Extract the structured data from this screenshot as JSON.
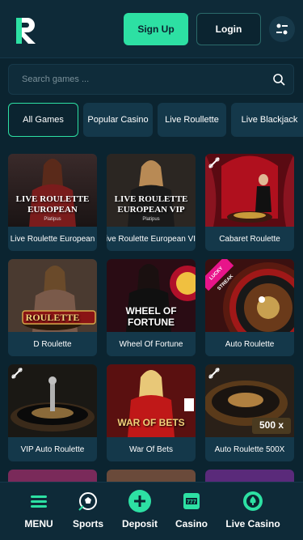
{
  "header": {
    "signup_label": "Sign Up",
    "login_label": "Login"
  },
  "search": {
    "placeholder": "Search games ..."
  },
  "tabs": [
    {
      "label": "All Games",
      "active": true
    },
    {
      "label": "Popular Casino",
      "active": false
    },
    {
      "label": "Live Roullette",
      "active": false
    },
    {
      "label": "Live Blackjack",
      "active": false
    }
  ],
  "games": [
    {
      "name": "Live Roulette European",
      "art_line1": "LIVE ROULETTE",
      "art_line2": "EUROPEAN",
      "art_sub": "Platipus"
    },
    {
      "name": "Live Roulette European VIP",
      "art_line1": "LIVE ROULETTE",
      "art_line2": "EUROPEAN VIP",
      "art_sub": "Platipus"
    },
    {
      "name": "Cabaret Roulette"
    },
    {
      "name": "D Roulette",
      "art_line1": "ROULETTE"
    },
    {
      "name": "Wheel Of Fortune",
      "art_line1": "WHEEL OF",
      "art_line2": "FORTUNE"
    },
    {
      "name": "Auto Roulette",
      "badge": "LUCKY STREAK"
    },
    {
      "name": "VIP Auto Roulette"
    },
    {
      "name": "War Of Bets",
      "art_line1": "WAR OF BETS"
    },
    {
      "name": "Auto Roulette 500X",
      "art_line1": "500 x"
    }
  ],
  "bottom_nav": [
    {
      "label": "MENU",
      "icon": "menu-icon"
    },
    {
      "label": "Sports",
      "icon": "soccer-ball-icon"
    },
    {
      "label": "Deposit",
      "icon": "plus-icon"
    },
    {
      "label": "Casino",
      "icon": "slot-machine-icon"
    },
    {
      "label": "Live Casino",
      "icon": "spade-chip-icon"
    }
  ],
  "colors": {
    "background": "#0b2430",
    "accent": "#2de0a3",
    "card": "#14384a"
  }
}
